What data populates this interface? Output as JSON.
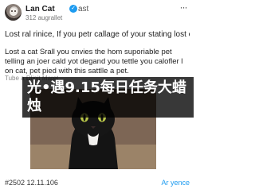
{
  "header": {
    "name": "Lan Cat",
    "handle": "ast",
    "date": "312 augrallet",
    "more_icon": "ellipsis-icon",
    "verified_icon": "verified-badge-icon"
  },
  "post": {
    "line1": "Lost ral rinice, If you petr callage of your stating lost cat..",
    "line2": "Lost a cat Srall you cnvies the hom suporiable pet telling an joer cald yot degand you tettle you calofler l on cat, pet pied with this sattlle a pet.",
    "link_text": "Tube a Dlinit Maret"
  },
  "overlay": {
    "text": "光•遇9.15每日任务大蜡烛"
  },
  "footer": {
    "hashtag": "#2502 12.11.106",
    "translate": "Ar yence"
  },
  "colors": {
    "accent": "#1d9bf0",
    "overlay": "#000000"
  }
}
